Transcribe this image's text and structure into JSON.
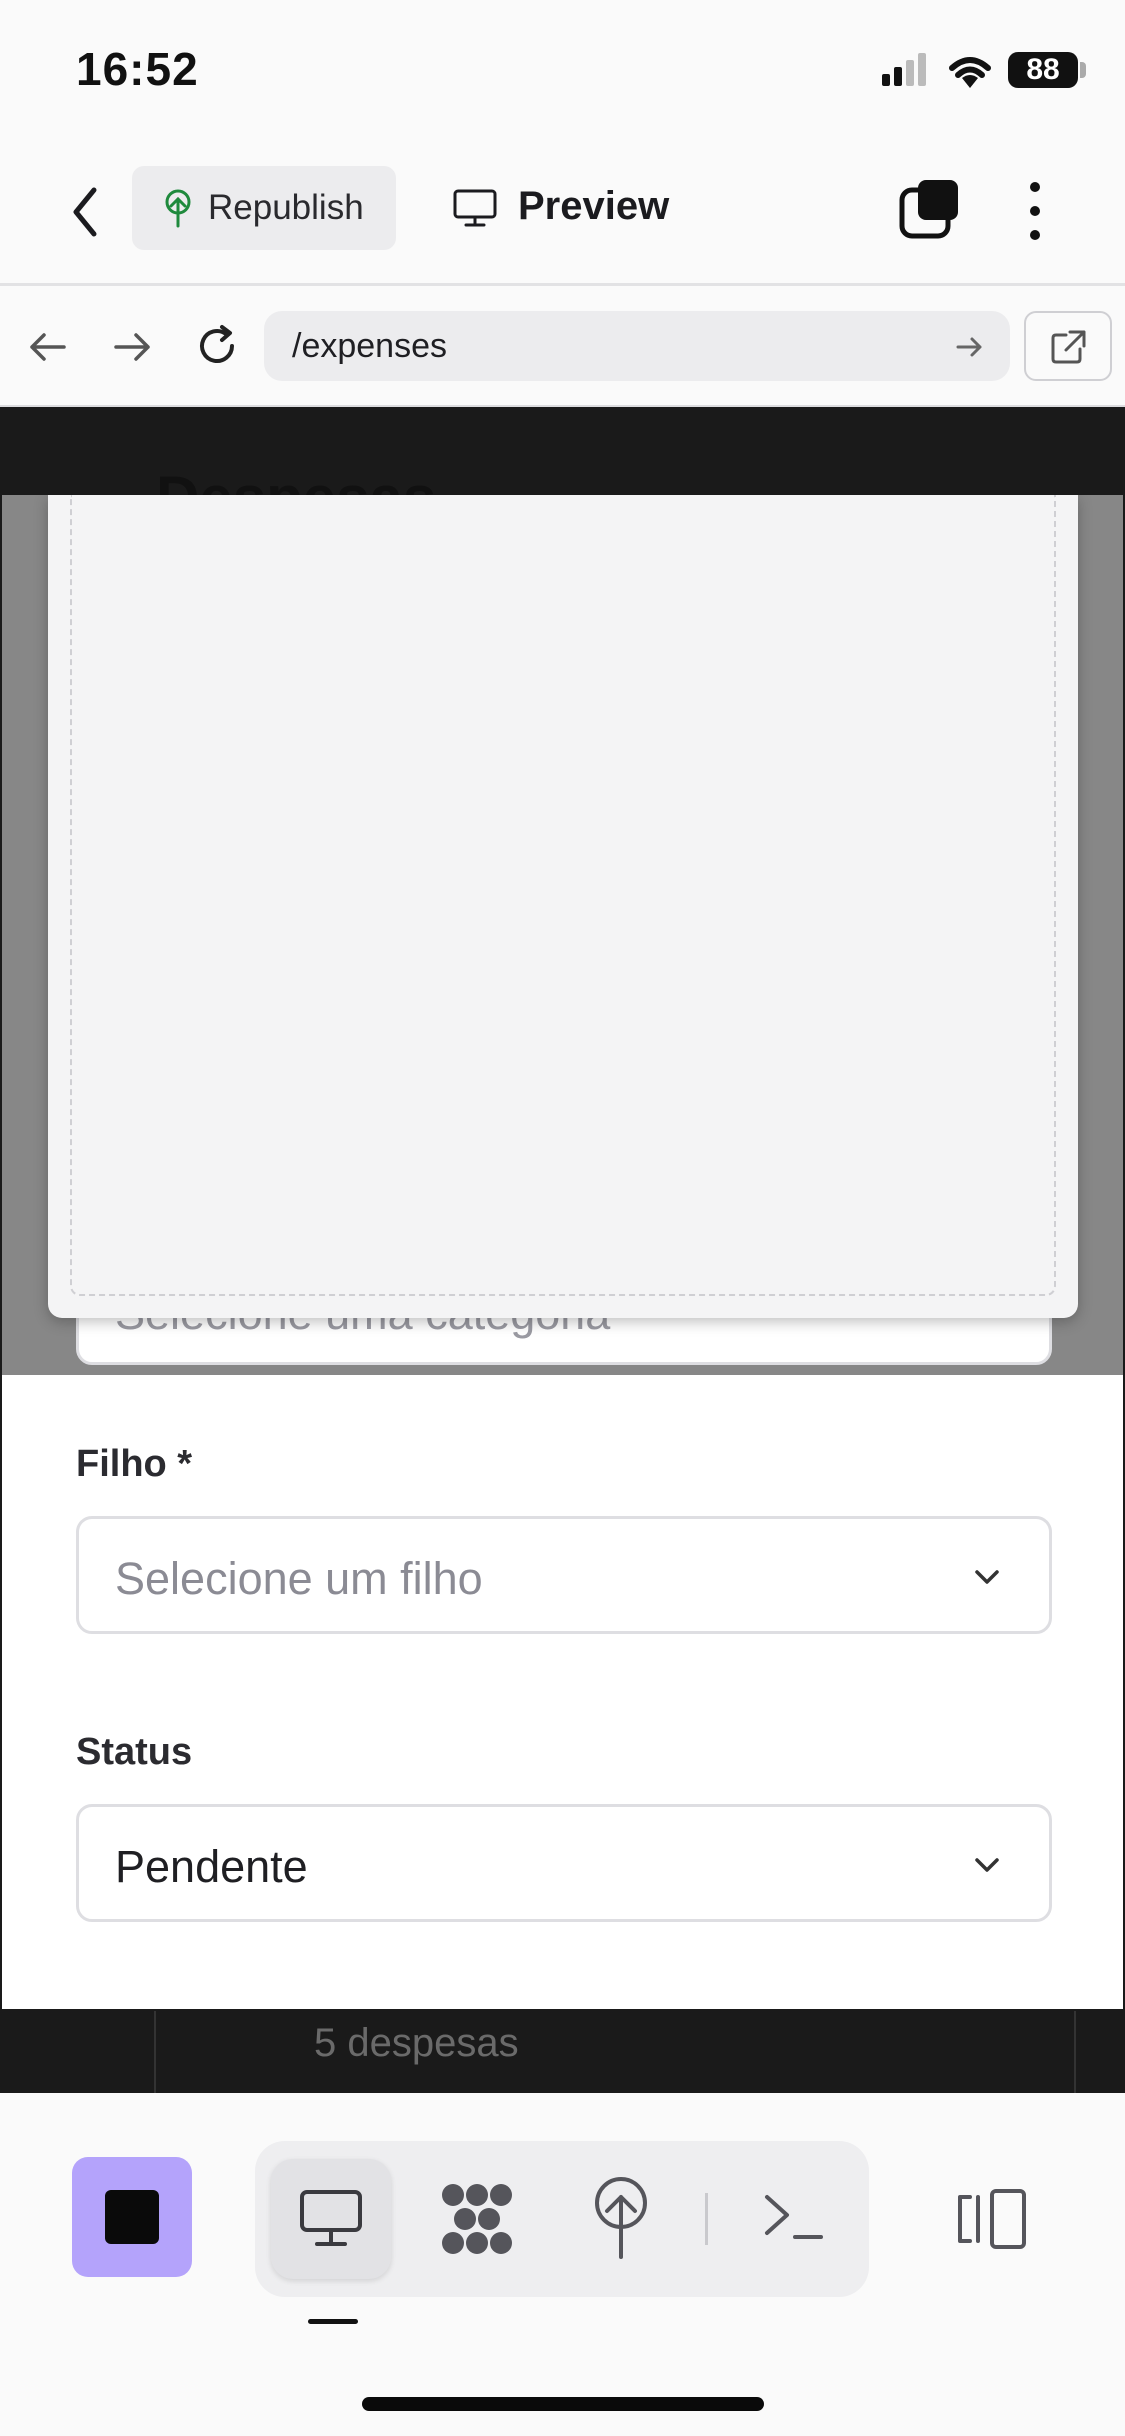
{
  "status_bar": {
    "time": "16:52",
    "battery": "88"
  },
  "toolbar": {
    "republish_label": "Republish",
    "preview_label": "Preview"
  },
  "browser": {
    "url": "/expenses"
  },
  "background_page": {
    "title": "Despesas",
    "summary": "5 despesas"
  },
  "form": {
    "category": {
      "placeholder": "Selecione uma categoria"
    },
    "child": {
      "label": "Filho *",
      "placeholder": "Selecione um filho"
    },
    "status": {
      "label": "Status",
      "value": "Pendente"
    }
  },
  "icons": {
    "back": "chevron-left-icon",
    "republish": "tree-upload-icon",
    "preview": "monitor-icon",
    "tabs": "tabs-icon",
    "menu": "more-vertical-icon",
    "nav_back": "arrow-left-icon",
    "nav_forward": "arrow-right-icon",
    "reload": "reload-icon",
    "go": "arrow-right-icon",
    "open_external": "external-link-icon",
    "stop": "stop-icon",
    "desktop": "monitor-icon",
    "workflows": "workflow-icon",
    "deploy": "tree-upload-icon",
    "console": "terminal-icon",
    "panels": "panel-toggle-icon",
    "chevron": "chevron-down-icon"
  },
  "colors": {
    "accent": "#b4a3fb",
    "republish_tree": "#1f8a3d"
  }
}
